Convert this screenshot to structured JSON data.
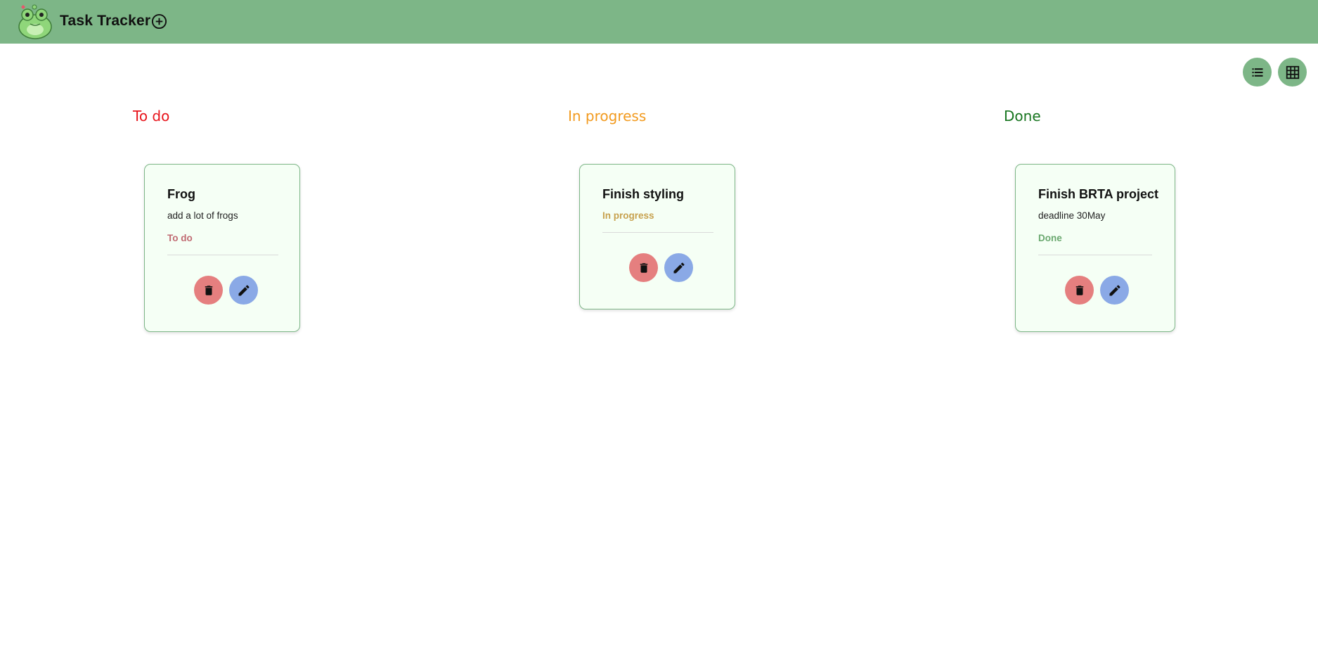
{
  "app": {
    "title": "Task Tracker"
  },
  "header": {
    "add_icon": "add-circle-icon",
    "logo": "frog-logo"
  },
  "view_toggle": {
    "list_icon": "list-icon",
    "grid_icon": "grid-icon"
  },
  "columns": [
    {
      "title": "To do",
      "color": "#e8141b"
    },
    {
      "title": "In progress",
      "color": "#f29a1e"
    },
    {
      "title": "Done",
      "color": "#17751f"
    }
  ],
  "tasks": [
    {
      "title": "Frog",
      "description": "add a lot of frogs",
      "status": "To do",
      "status_color": "#c06a72"
    },
    {
      "title": "Finish styling",
      "description": "",
      "status": "In progress",
      "status_color": "#c7a14e"
    },
    {
      "title": "Finish BRTA project",
      "description": "deadline 30May",
      "status": "Done",
      "status_color": "#6aa86f"
    }
  ],
  "actions": {
    "delete_icon": "trash-icon",
    "edit_icon": "pencil-icon"
  },
  "colors": {
    "header_bg": "#7db687",
    "card_bg": "#f5fff5",
    "delete_bg": "#e57f7f",
    "edit_bg": "#8aa9e6"
  }
}
